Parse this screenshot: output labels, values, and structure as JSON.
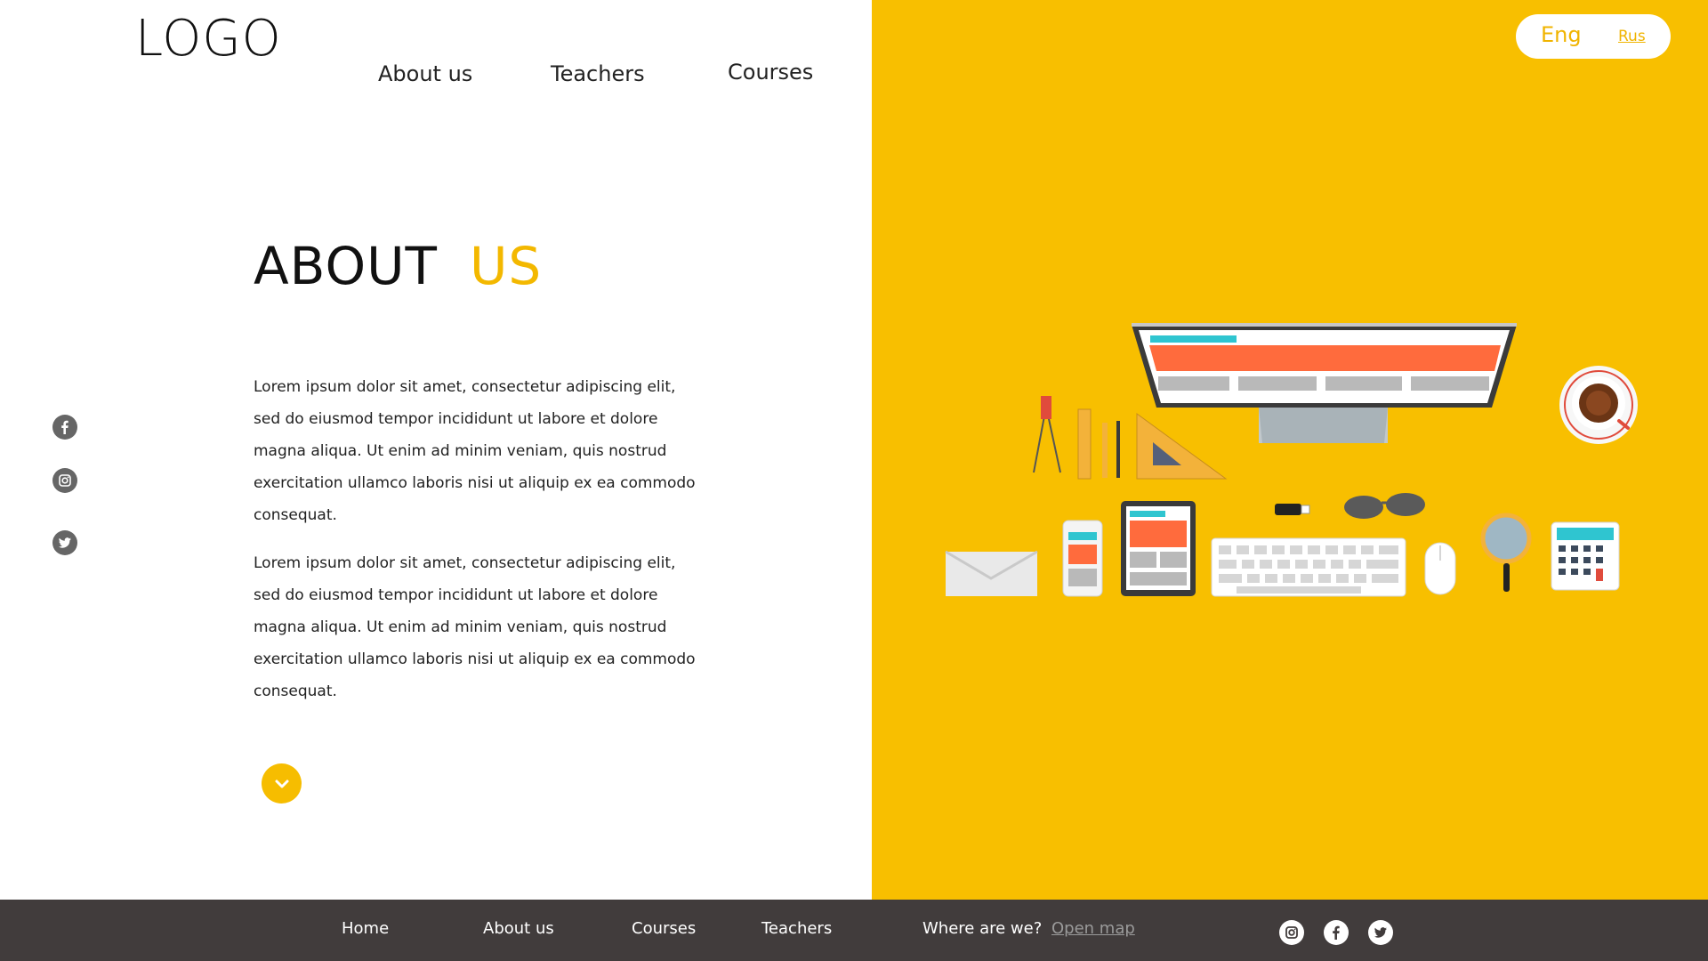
{
  "header": {
    "logo": "LOGO",
    "nav": [
      {
        "label": "About us"
      },
      {
        "label": "Teachers"
      },
      {
        "label": "Courses"
      }
    ],
    "lang": {
      "eng": "Eng",
      "rus": "Rus"
    }
  },
  "main": {
    "title_part1": "ABOUT",
    "title_part2": "US",
    "paragraphs": [
      "Lorem ipsum dolor sit amet, consectetur adipiscing elit, sed  do eiusmod tempor incididunt  ut labore  et dolore magna aliqua. Ut enim ad minim veniam, quis nostrud exercitation ullamco laboris nisi ut  aliquip ex ea commodo consequat.",
      "Lorem ipsum dolor sit amet, consectetur adipiscing elit, sed  do eiusmod tempor incididunt  ut labore  et dolore magna aliqua. Ut enim ad minim veniam, quis nostrud exercitation ullamco laboris nisi ut  aliquip ex ea commodo consequat."
    ]
  },
  "social_side": [
    {
      "icon": "facebook-icon"
    },
    {
      "icon": "instagram-icon"
    },
    {
      "icon": "twitter-icon"
    }
  ],
  "footer": {
    "links": [
      "Home",
      "About  us",
      "Courses",
      "Teachers"
    ],
    "where": "Where are we?",
    "map_link": "Open map",
    "icons": [
      "instagram-icon",
      "facebook-icon",
      "twitter-icon"
    ]
  },
  "colors": {
    "accent": "#f8bf00",
    "footer_bg": "#413c3c",
    "text": "#222222"
  }
}
